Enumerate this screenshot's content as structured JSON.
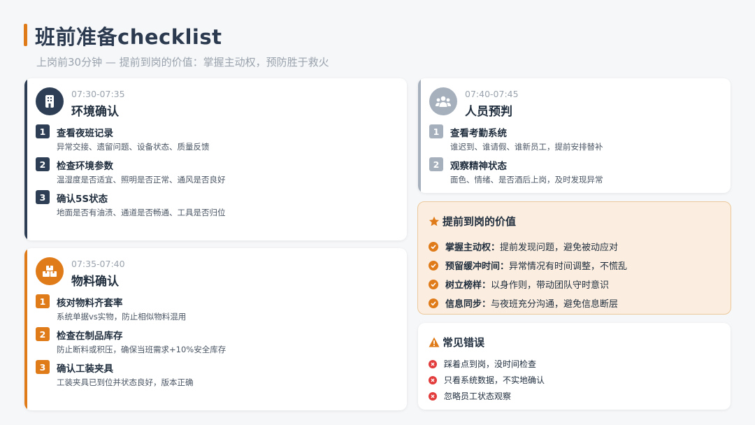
{
  "header": {
    "title": "班前准备checklist",
    "subtitle": "上岗前30分钟 — 提前到岗的价值：掌握主动权，预防胜于救火"
  },
  "colors": {
    "accent_orange": "#e07b1a",
    "navy": "#2d3e55",
    "slate": "#a6b0bd",
    "error_red": "#e23c3c"
  },
  "cards": {
    "environment": {
      "time": "07:30-07:35",
      "title": "环境确认",
      "icon": "building-icon",
      "items": [
        {
          "num": "1",
          "title": "查看夜班记录",
          "desc": "异常交接、遗留问题、设备状态、质量反馈"
        },
        {
          "num": "2",
          "title": "检查环境参数",
          "desc": "温湿度是否适宜、照明是否正常、通风是否良好"
        },
        {
          "num": "3",
          "title": "确认5S状态",
          "desc": "地面是否有油渍、通道是否畅通、工具是否归位"
        }
      ]
    },
    "materials": {
      "time": "07:35-07:40",
      "title": "物料确认",
      "icon": "boxes-icon",
      "items": [
        {
          "num": "1",
          "title": "核对物料齐套率",
          "desc": "系统单据vs实物，防止相似物料混用"
        },
        {
          "num": "2",
          "title": "检查在制品库存",
          "desc": "防止断料或积压，确保当班需求+10%安全库存"
        },
        {
          "num": "3",
          "title": "确认工装夹具",
          "desc": "工装夹具已到位并状态良好，版本正确"
        }
      ]
    },
    "people": {
      "time": "07:40-07:45",
      "title": "人员预判",
      "icon": "people-icon",
      "items": [
        {
          "num": "1",
          "title": "查看考勤系统",
          "desc": "谁迟到、谁请假、谁新员工，提前安排替补"
        },
        {
          "num": "2",
          "title": "观察精神状态",
          "desc": "面色、情绪、是否酒后上岗，及时发现异常"
        }
      ]
    }
  },
  "value_panel": {
    "title": "提前到岗的价值",
    "icon": "star-icon",
    "rows": [
      {
        "key": "掌握主动权：",
        "text": "提前发现问题，避免被动应对"
      },
      {
        "key": "预留缓冲时间：",
        "text": "异常情况有时间调整，不慌乱"
      },
      {
        "key": "树立榜样：",
        "text": "以身作则，带动团队守时意识"
      },
      {
        "key": "信息同步：",
        "text": "与夜班充分沟通，避免信息断层"
      }
    ]
  },
  "errors_panel": {
    "title": "常见错误",
    "icon": "warning-icon",
    "rows": [
      "踩着点到岗，没时间检查",
      "只看系统数据，不实地确认",
      "忽略员工状态观察"
    ]
  }
}
